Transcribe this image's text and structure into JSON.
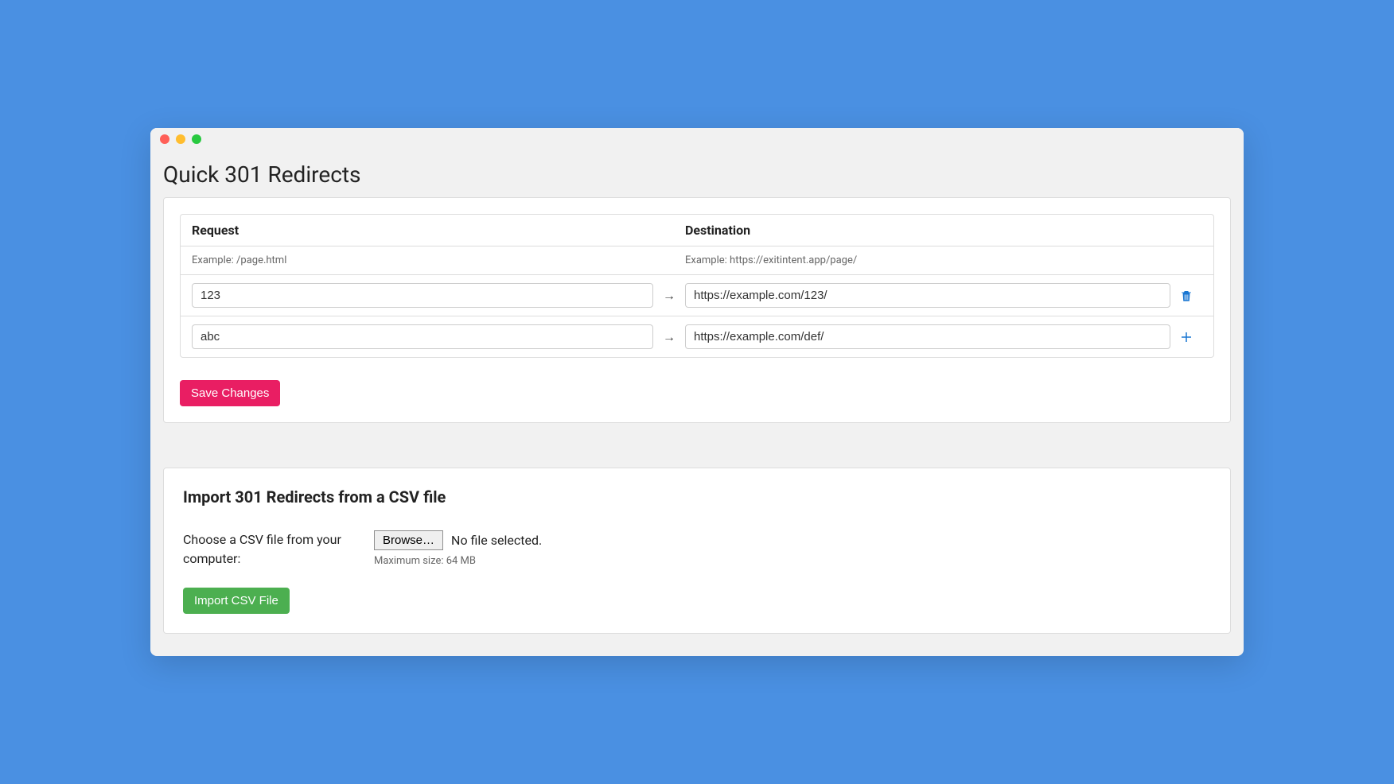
{
  "page_title": "Quick 301 Redirects",
  "table": {
    "header_request": "Request",
    "header_destination": "Destination",
    "example_request": "Example: /page.html",
    "example_destination": "Example: https://exitintent.app/page/",
    "rows": [
      {
        "request": "123",
        "destination": "https://example.com/123/"
      },
      {
        "request": "abc",
        "destination": "https://example.com/def/"
      }
    ],
    "arrow": "→"
  },
  "save_button": "Save Changes",
  "import": {
    "title": "Import 301 Redirects from a CSV file",
    "choose_label": "Choose a CSV file from your computer:",
    "browse_button": "Browse…",
    "file_status": "No file selected.",
    "max_size": "Maximum size: 64 MB",
    "import_button": "Import CSV File"
  }
}
